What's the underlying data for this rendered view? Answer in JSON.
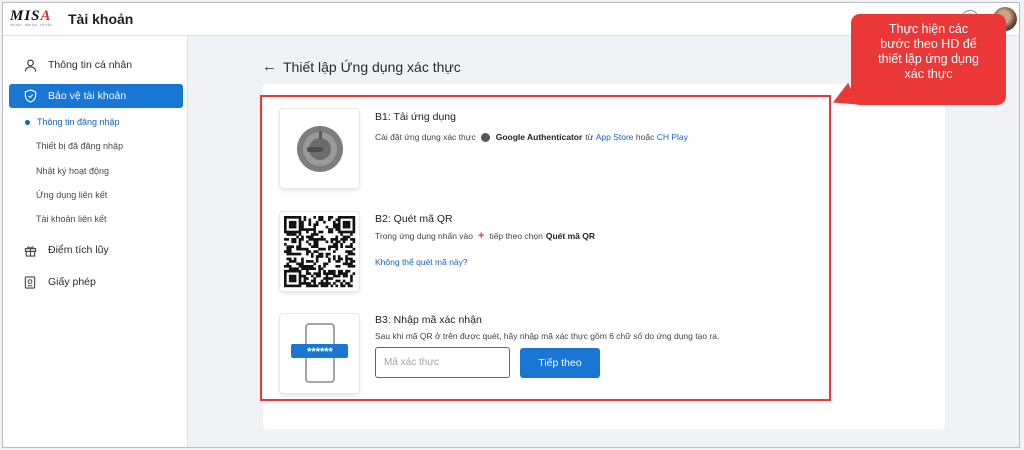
{
  "header": {
    "logo_text": "MISA",
    "logo_tagline": "TIN CẬY · TIỆN ÍCH · TỐI TÂN",
    "app_title": "Tài khoản"
  },
  "sidebar": {
    "items": [
      {
        "label": "Thông tin cá nhân",
        "icon": "person-icon"
      },
      {
        "label": "Bảo vệ tài khoản",
        "icon": "shield-icon",
        "active": true
      },
      {
        "label": "Điểm tích lũy",
        "icon": "gift-icon"
      },
      {
        "label": "Giấy phép",
        "icon": "license-icon"
      }
    ],
    "subitems": [
      {
        "label": "Thông tin đăng nhập",
        "active": true
      },
      {
        "label": "Thiết bị đã đăng nhập"
      },
      {
        "label": "Nhật ký hoạt động"
      },
      {
        "label": "Ứng dụng liên kết"
      },
      {
        "label": "Tài khoản liên kết"
      }
    ]
  },
  "main": {
    "title": "Thiết lập Ứng dụng xác thực",
    "steps": {
      "b1": {
        "title": "B1: Tải ứng dụng",
        "desc_prefix": "Cài đặt ứng dụng xác thực",
        "app_name": "Google Authenticator",
        "from_text": "từ",
        "app_store": "App Store",
        "or_text": "hoặc",
        "ch_play": "CH Play"
      },
      "b2": {
        "title": "B2: Quét mã QR",
        "desc_prefix": "Trong ứng dụng nhấn vào",
        "desc_mid": "tiếp theo chọn",
        "desc_action": "Quét mã QR",
        "cant_scan": "Không thể quét mã này?"
      },
      "b3": {
        "title": "B3: Nhập mã xác nhận",
        "desc": "Sau khi mã QR ở trên được quét, hãy nhập mã xác thực gồm 6 chữ số do ứng dụng tạo ra.",
        "input_placeholder": "Mã xác thực",
        "input_value": "",
        "next_label": "Tiếp theo",
        "mask": "******"
      }
    }
  },
  "callout": {
    "lines": [
      "Thực hiện các",
      "bước theo HD để",
      "thiết lập ứng dụng",
      "xác thực"
    ]
  },
  "colors": {
    "primary": "#1976d2",
    "highlight": "#e53935",
    "callout": "#ea3838"
  }
}
